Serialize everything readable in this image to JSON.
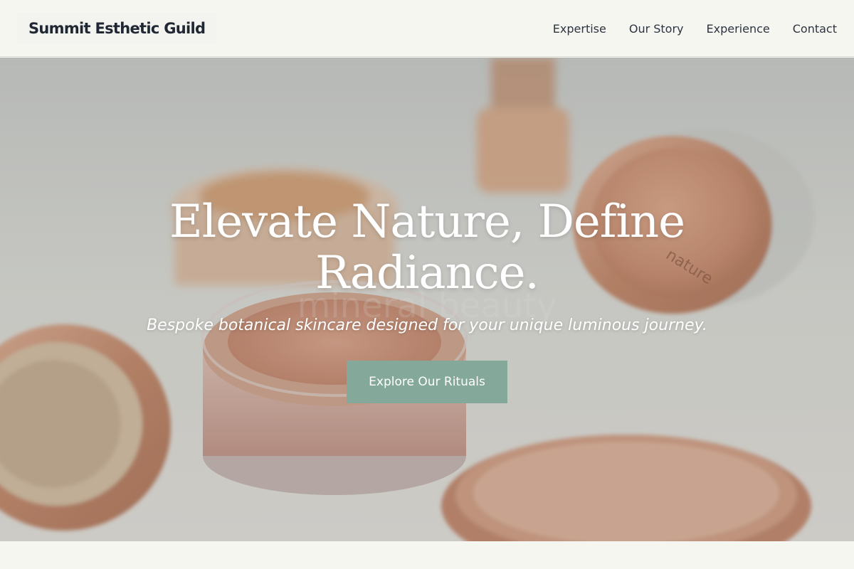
{
  "header": {
    "brand": "Summit Esthetic Guild",
    "nav": [
      {
        "label": "Expertise"
      },
      {
        "label": "Our Story"
      },
      {
        "label": "Experience"
      },
      {
        "label": "Contact"
      }
    ]
  },
  "hero": {
    "title": "Elevate Nature, Define Radiance.",
    "subtitle": "Bespoke botanical skincare designed for your unique luminous journey.",
    "cta_label": "Explore Our Rituals",
    "photo_text": "mineral beauty",
    "lid_text": "nature"
  },
  "colors": {
    "accent": "#84a89a",
    "background": "#f6f6f1",
    "text": "#1f2733"
  }
}
